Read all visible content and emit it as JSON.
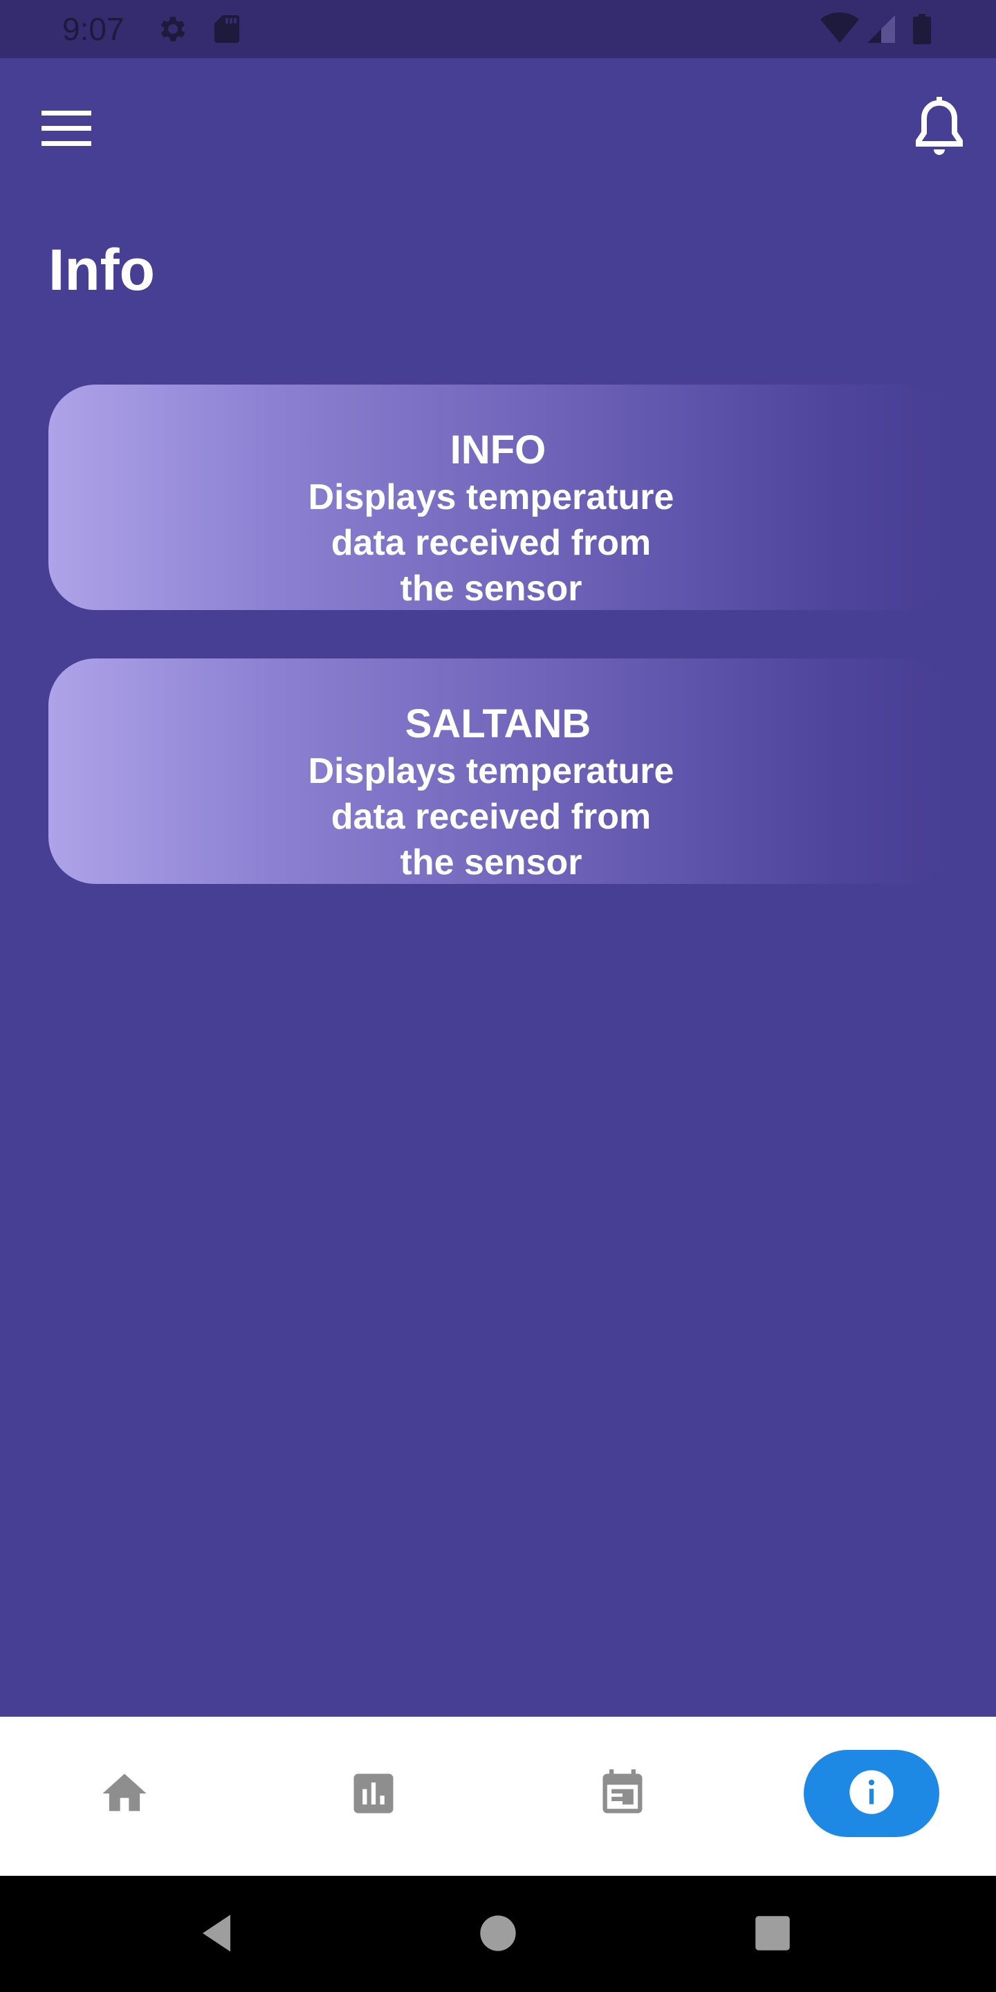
{
  "status_bar": {
    "time": "9:07",
    "icons": [
      "settings-icon",
      "sd-card-icon",
      "wifi-icon",
      "signal-icon",
      "battery-icon"
    ]
  },
  "app_bar": {
    "menu_icon": "menu-icon",
    "notification_icon": "bell-icon"
  },
  "page": {
    "title": "Info"
  },
  "cards": [
    {
      "title": "INFO",
      "description": "Displays temperature data received from the sensor"
    },
    {
      "title": "SALTANB",
      "description": "Displays temperature data received from the sensor"
    }
  ],
  "bottom_nav": {
    "items": [
      {
        "icon": "home-icon",
        "active": false
      },
      {
        "icon": "bar-chart-icon",
        "active": false
      },
      {
        "icon": "calendar-icon",
        "active": false
      },
      {
        "icon": "info-icon",
        "active": true
      }
    ],
    "active_color": "#1E88E5",
    "inactive_color": "#8E8E8E"
  },
  "system_nav": {
    "icons": [
      "back-icon",
      "home-circle-icon",
      "recents-icon"
    ]
  },
  "colors": {
    "background": "#473F94",
    "status_bar": "#342C6F",
    "card_gradient_start": "#AEA3E8",
    "card_gradient_end": "#473F94"
  }
}
